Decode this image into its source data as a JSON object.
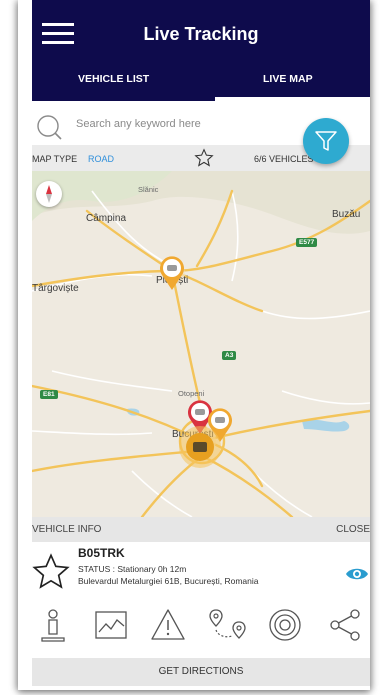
{
  "header": {
    "title": "Live Tracking",
    "tabs": [
      {
        "label": "VEHICLE LIST"
      },
      {
        "label": "LIVE MAP",
        "active": true
      }
    ]
  },
  "search": {
    "placeholder": "Search any keyword here"
  },
  "filter": {
    "icon": "filter-funnel-icon",
    "color": "#2eaad0"
  },
  "map_bar": {
    "map_type_label": "MAP TYPE",
    "map_type_value": "ROAD",
    "vehicle_count": "6/6 VEHICLES"
  },
  "map": {
    "places": [
      "Câmpina",
      "Buzău",
      "Ploiești",
      "Târgoviște",
      "Otopeni",
      "București"
    ],
    "small_places": [
      "Slănic"
    ],
    "road_badges": [
      "E577",
      "A3",
      "E81"
    ]
  },
  "vehicle_info": {
    "title": "VEHICLE INFO",
    "close": "CLOSE",
    "plate": "B05TRK",
    "status": "STATUS : Stationary 0h 12m",
    "address": "Bulevardul Metalurgiei 61B, București, Romania"
  },
  "actions": [
    "driver-icon",
    "chart-icon",
    "alert-icon",
    "route-icon",
    "geofence-icon",
    "share-icon"
  ],
  "directions_label": "GET DIRECTIONS",
  "colors": {
    "header_bg": "#0e0b4c",
    "accent_blue": "#2f8fdb",
    "marker_orange": "#f0a830",
    "marker_red": "#d93340"
  }
}
